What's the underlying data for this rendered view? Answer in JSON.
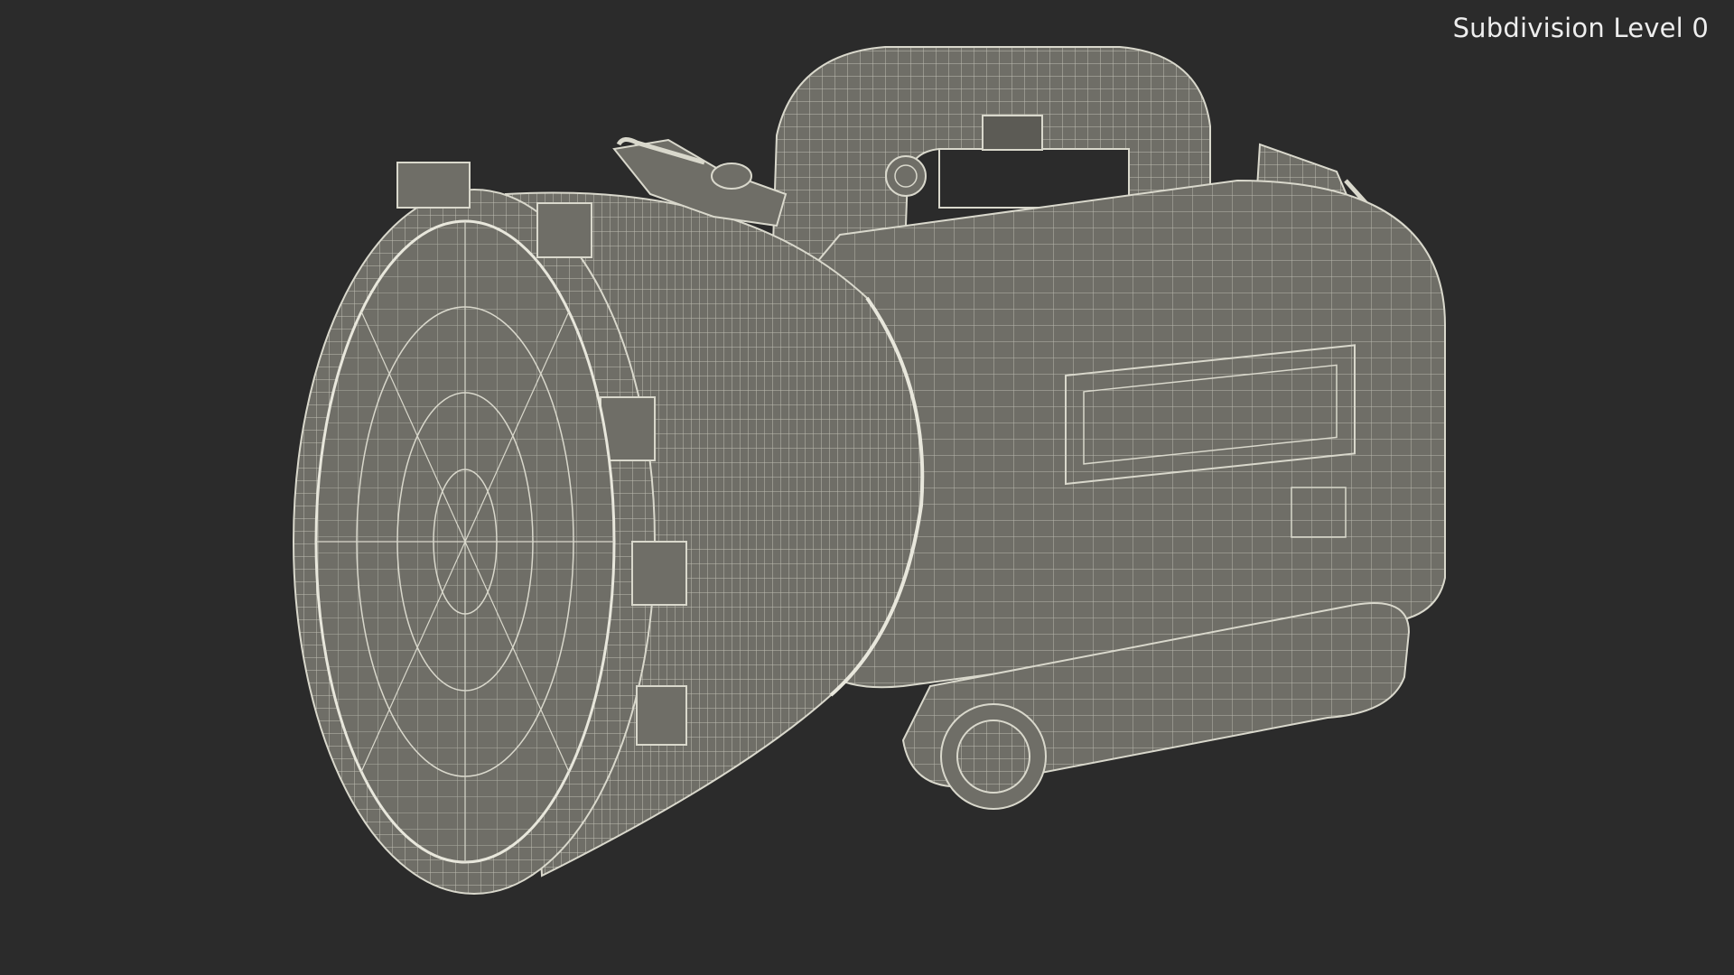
{
  "viewport": {
    "label": "Subdivision Level 0"
  },
  "model": {
    "subject": "flashlight-wireframe-icon"
  },
  "colors": {
    "background": "#2b2b2b",
    "surface": "#6f6e67",
    "surface_dark": "#5c5b55",
    "wire": "#d9d8cc",
    "label": "#eeeeee"
  }
}
